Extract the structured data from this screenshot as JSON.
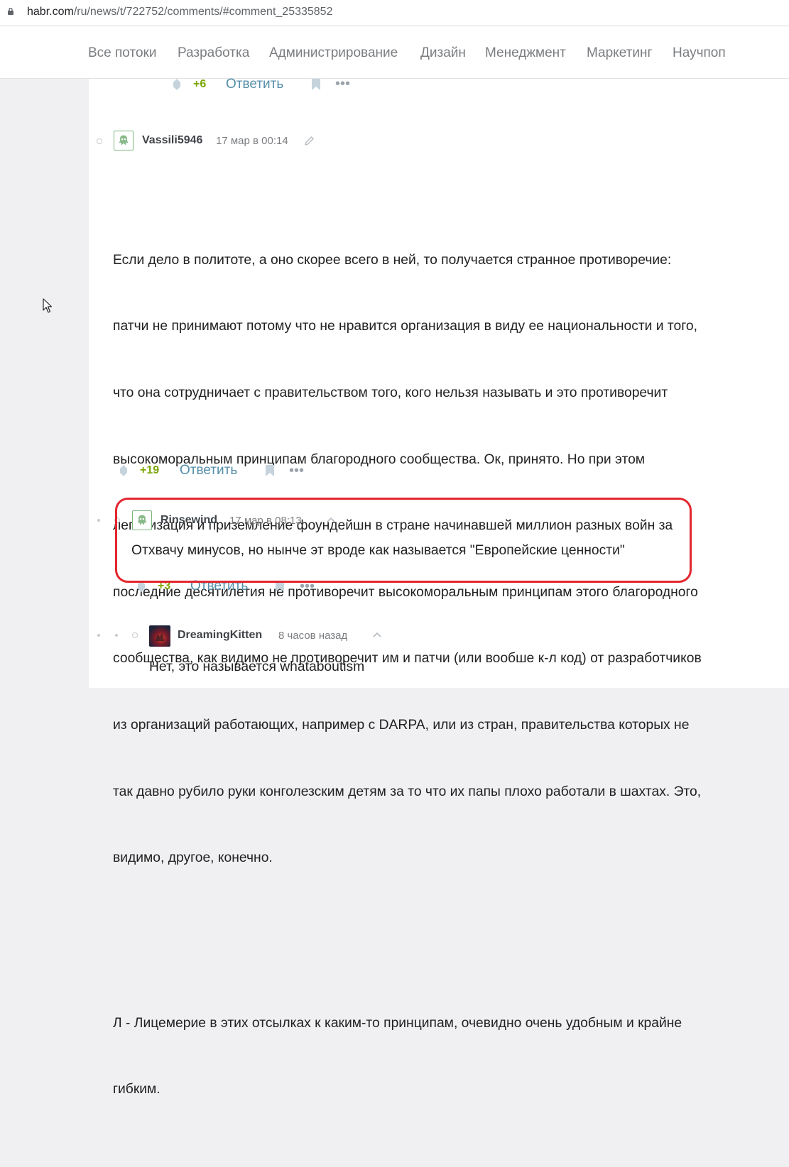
{
  "browser": {
    "url_prefix": "habr.com",
    "url_path": "/ru/news/t/722752/comments/#comment_25335852"
  },
  "nav": {
    "items": [
      "Все потоки",
      "Разработка",
      "Администрирование",
      "Дизайн",
      "Менеджмент",
      "Маркетинг",
      "Научпоп"
    ]
  },
  "comments": {
    "prev": {
      "score": "+6",
      "reply_label": "Ответить"
    },
    "c1": {
      "username": "Vassili5946",
      "time": "17 мар в 00:14",
      "paragraph1": [
        "Если дело в политоте, а оно скорее всего в ней, то получается странное противоречие:",
        "патчи не принимают потому что не нравится организация в виду ее национальности и того,",
        "что она сотрудничает с правительством того, кого нельзя называть и это противоречит",
        "высокоморальным принципам благородного сообщества. Ок, принято. Но при этом",
        "легализация и приземление фоундейшн в стране начинавшей миллион разных войн за",
        "последние десятилетия не противоречит высокоморальным принципам этого благородного",
        "сообщества, как видимо не противоречит им и патчи (или вообше к-л код) от разработчиков",
        "из организаций работающих, например с DARPA, или из стран, правительства которых не",
        "так давно рубило руки конголезским детям за то что их папы плохо работали в шахтах. Это,",
        "видимо, другое, конечно."
      ],
      "paragraph2": [
        "Л - Лицемерие в этих отсылках к каким-то принципам, очевидно очень удобным и крайне",
        "гибким."
      ],
      "score": "+19",
      "reply_label": "Ответить"
    },
    "c2": {
      "username": "Rinsewind",
      "time": "17 мар в 08:13",
      "text": "Отхвачу минусов, но нынче эт вроде как называется \"Европейские ценности\"",
      "score": "+3",
      "reply_label": "Ответить"
    },
    "c3": {
      "username": "DreamingKitten",
      "time": "8 часов назад",
      "text": "Нет, это называется whataboutism"
    }
  },
  "colors": {
    "score_positive": "#7aa600",
    "link": "#548eaa",
    "highlight": "#e3262e"
  }
}
